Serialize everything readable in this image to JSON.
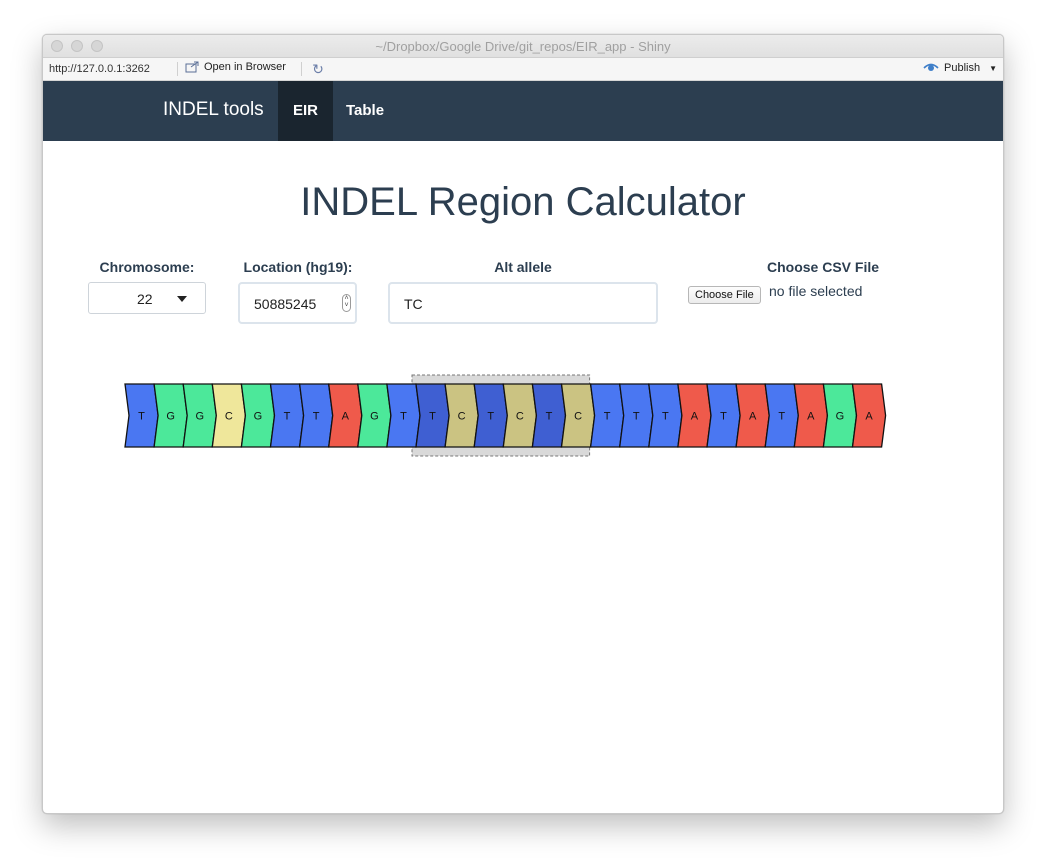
{
  "window": {
    "title": "~/Dropbox/Google Drive/git_repos/EIR_app - Shiny"
  },
  "toolbar": {
    "url": "http://127.0.0.1:3262",
    "open_in_browser": "Open in Browser",
    "publish": "Publish"
  },
  "navbar": {
    "brand": "INDEL tools",
    "tabs": [
      {
        "label": "EIR",
        "active": true
      },
      {
        "label": "Table",
        "active": false
      }
    ]
  },
  "main": {
    "title": "INDEL Region Calculator",
    "chromosome": {
      "label": "Chromosome:",
      "value": "22"
    },
    "location": {
      "label": "Location (hg19):",
      "value": "50885245"
    },
    "alt_allele": {
      "label": "Alt allele",
      "value": "TC"
    },
    "csv": {
      "label": "Choose CSV File",
      "button": "Choose File",
      "status": "no file selected"
    }
  },
  "sequence": {
    "bases": [
      "T",
      "G",
      "G",
      "C",
      "G",
      "T",
      "T",
      "A",
      "G",
      "T",
      "T",
      "C",
      "T",
      "C",
      "T",
      "C",
      "T",
      "T",
      "T",
      "A",
      "T",
      "A",
      "T",
      "A",
      "G",
      "A"
    ],
    "highlight": {
      "start_index": 10,
      "end_index": 15
    },
    "colors": {
      "A": "#ef5a4b",
      "T": "#4a77f2",
      "G": "#4ce89a",
      "C": "#efe79b"
    },
    "highlight_colors": {
      "T": "#3f5fd2",
      "C": "#cbc382"
    }
  }
}
